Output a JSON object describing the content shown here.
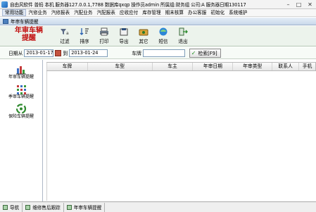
{
  "window": {
    "title": "自由风软件  普蚂  本机  服务器127.0.0.1,7788  数据库qxqp  操作员admin  所属组:财务组  公司:A  服务器日期130117",
    "buttons": {
      "minimize": "–",
      "maximize": "□",
      "close": "✕"
    }
  },
  "menu": [
    "常用功能",
    "汽修业务",
    "汽修报表",
    "汽配业务",
    "汽配报表",
    "应收应付",
    "库存管理",
    "期末核算",
    "办公客服",
    "初始化",
    "系统维护"
  ],
  "doc": {
    "title": "年审车辆提醒"
  },
  "toolbar": {
    "brand_line1": "年审车辆",
    "brand_line2": "提醒",
    "tools": [
      {
        "label": "过滤",
        "icon": "filter-icon"
      },
      {
        "label": "排序",
        "icon": "sort-icon"
      },
      {
        "label": "打印",
        "icon": "print-icon"
      },
      {
        "label": "导出",
        "icon": "export-icon"
      },
      {
        "label": "其它",
        "icon": "other-icon"
      },
      {
        "label": "短信",
        "icon": "sms-icon"
      },
      {
        "label": "退出",
        "icon": "exit-icon"
      }
    ]
  },
  "filter": {
    "date_from_label": "日期从",
    "date_from": "2013-01-17",
    "date_to_label": "到",
    "date_to": "2013-01-24",
    "plate_label": "车牌",
    "plate_value": "",
    "search_label": "检索[F9]"
  },
  "nav": [
    {
      "label": "年审车辆提醒",
      "icon": "bar-chart-icon"
    },
    {
      "label": "季审车辆提醒",
      "icon": "grid-dots-icon"
    },
    {
      "label": "保险车辆提醒",
      "icon": "recycle-icon"
    }
  ],
  "grid": {
    "columns": [
      "车牌",
      "车型",
      "车主",
      "年审日期",
      "年审类型",
      "联系人",
      "手机"
    ]
  },
  "status": {
    "tabs": [
      "导航",
      "维修售后跟踪",
      "年审车辆提醒"
    ]
  },
  "colors": {
    "brand_red": "#c11010",
    "toolbar_bg": "#ecf3ec",
    "doc_bar": "#c9d8ea"
  }
}
